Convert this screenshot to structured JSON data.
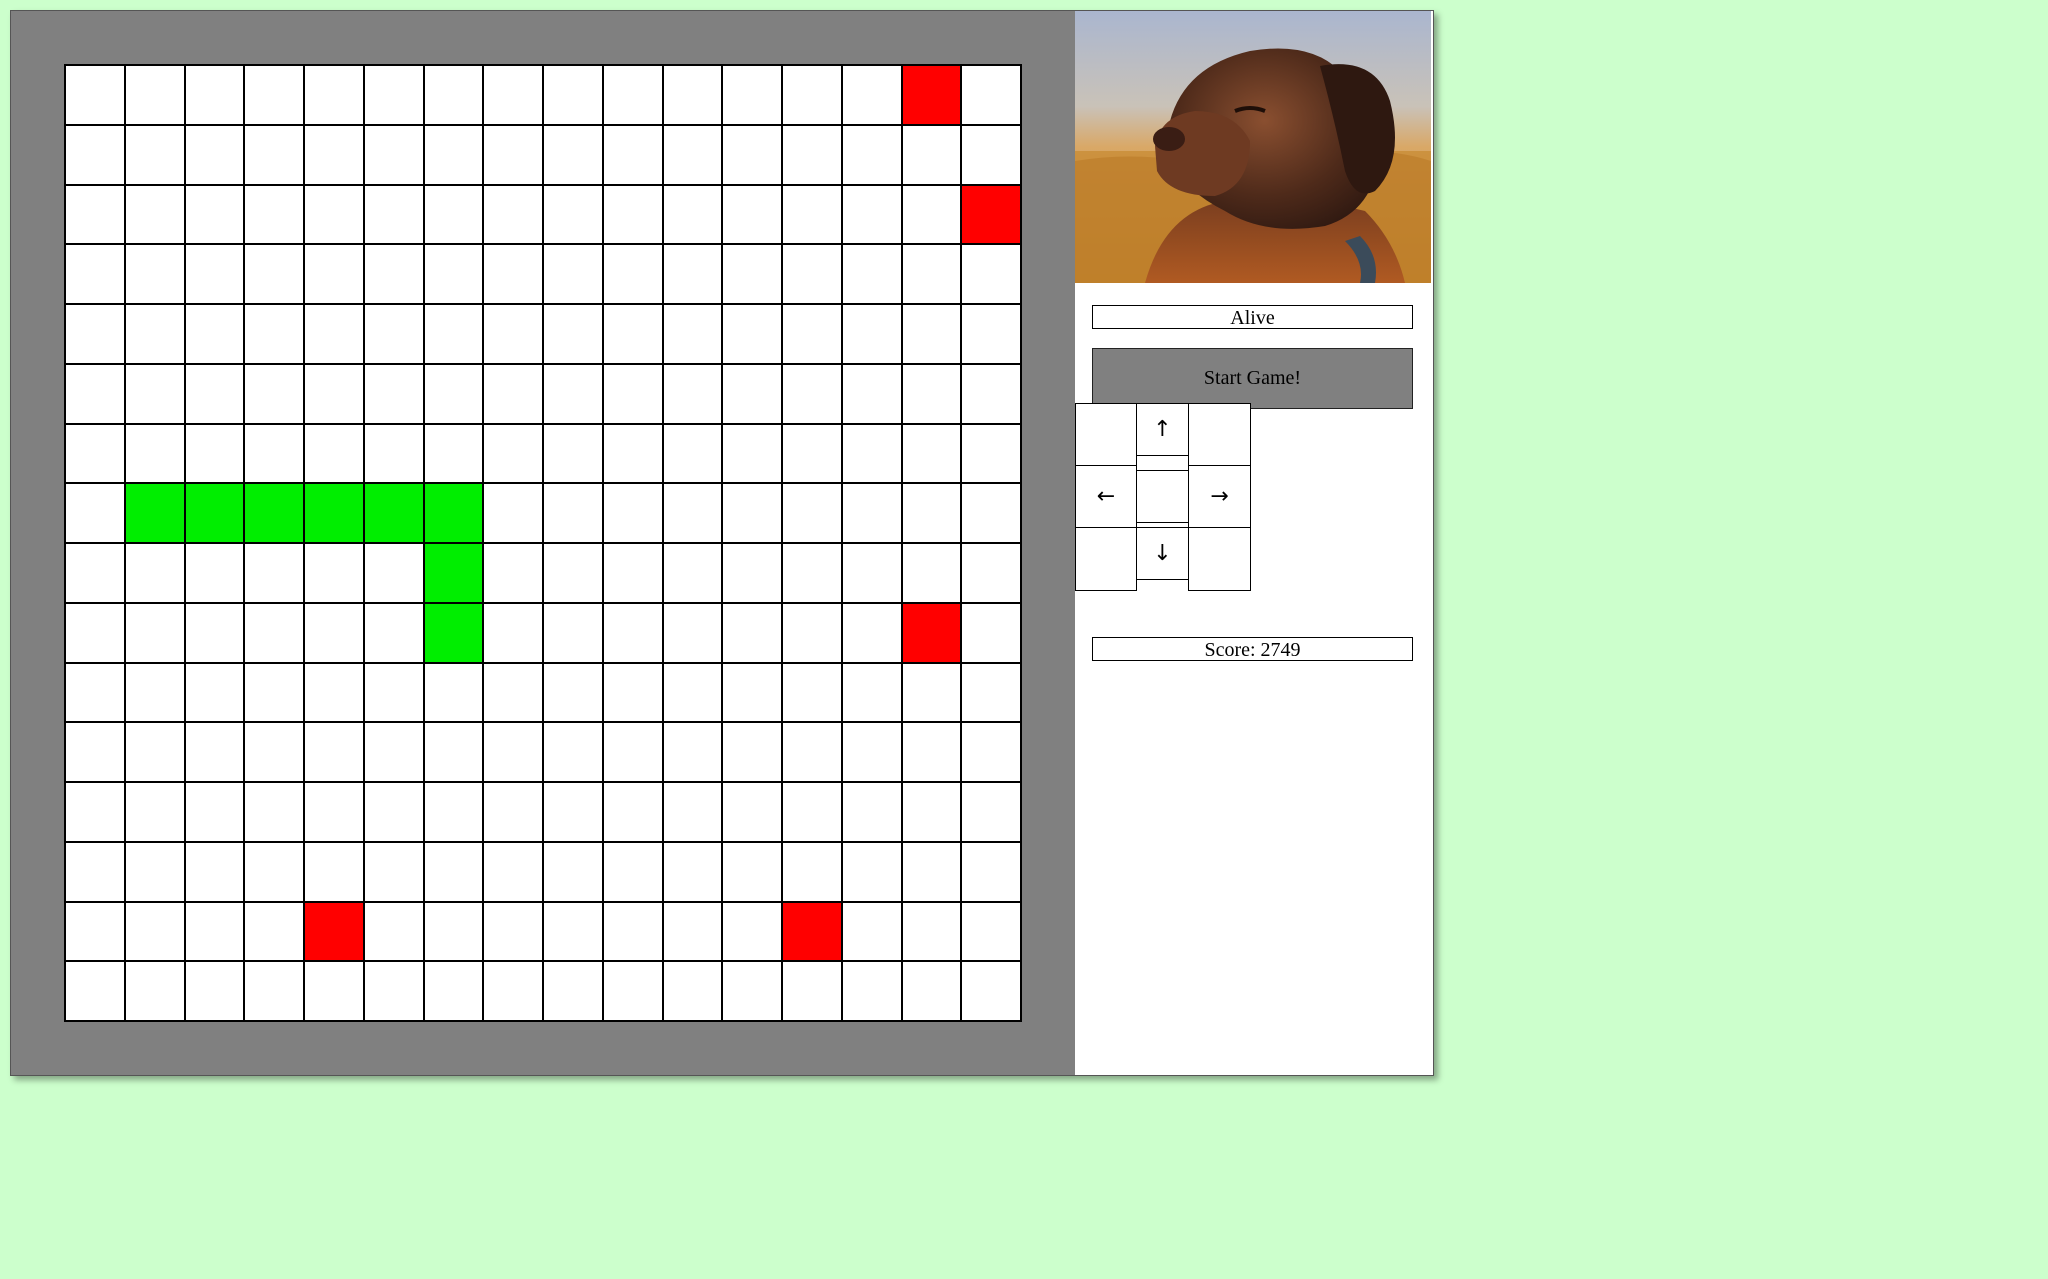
{
  "status": {
    "text": "Alive"
  },
  "start_button": {
    "label": "Start Game!"
  },
  "dpad": {
    "up_label": "↑",
    "down_label": "↓",
    "left_label": "←",
    "right_label": "→"
  },
  "score": {
    "text": "Score: 2749"
  },
  "board": {
    "columns": 16,
    "rows": 16,
    "snake_cells": [
      [
        7,
        1
      ],
      [
        7,
        2
      ],
      [
        7,
        3
      ],
      [
        7,
        4
      ],
      [
        7,
        5
      ],
      [
        7,
        6
      ],
      [
        8,
        6
      ],
      [
        9,
        6
      ]
    ],
    "food_cells": [
      [
        0,
        14
      ],
      [
        2,
        15
      ],
      [
        9,
        14
      ],
      [
        14,
        4
      ],
      [
        14,
        12
      ]
    ]
  },
  "colors": {
    "background": "#ccffcc",
    "board_frame": "#808080",
    "snake": "#00ee00",
    "food": "#ff0000",
    "empty_cell": "#ffffff",
    "button": "#808080"
  },
  "image": {
    "icon": "dog-photo"
  }
}
